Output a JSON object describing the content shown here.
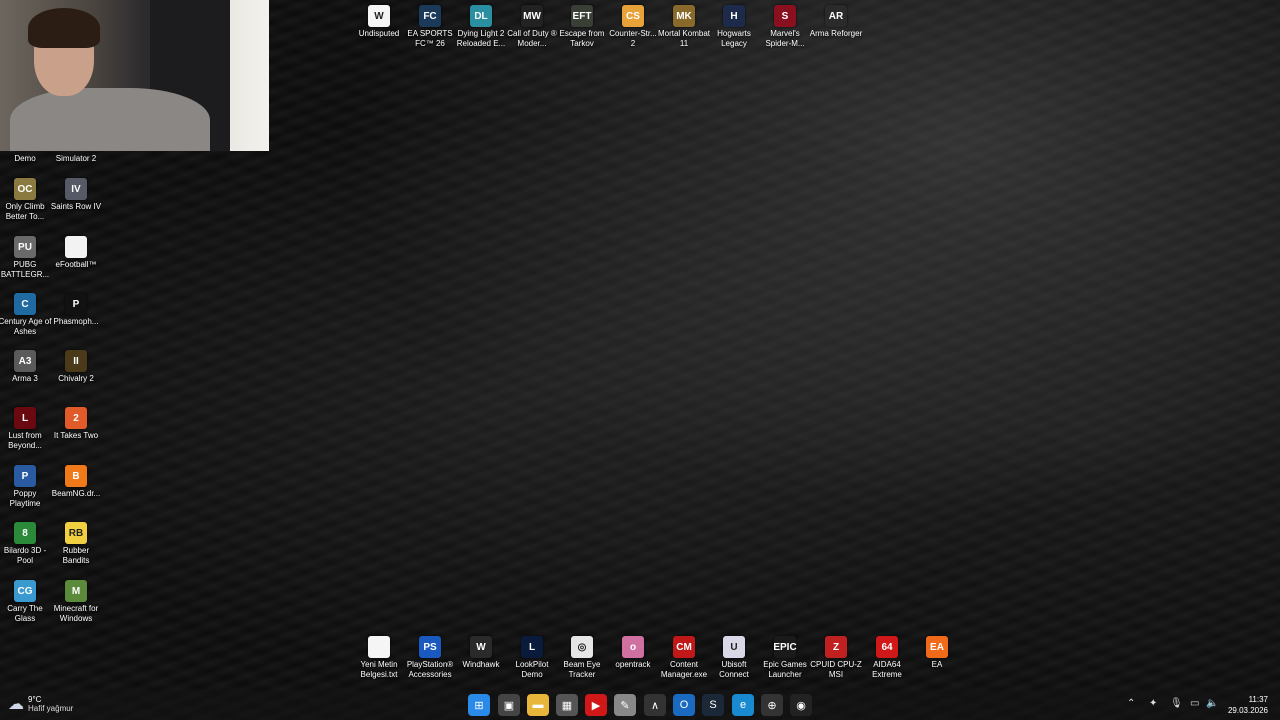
{
  "desktop": {
    "top_icons": [
      {
        "label": "Undisputed",
        "icon": "undisputed-icon",
        "color": "#f5f5f5",
        "glyph": "W"
      },
      {
        "label": "EA SPORTS FC™ 26",
        "icon": "ea-fc-icon",
        "color": "#1b3a5a",
        "glyph": "FC"
      },
      {
        "label": "Dying Light 2 Reloaded E...",
        "icon": "dying-light-icon",
        "color": "#2a8fa0",
        "glyph": "DL"
      },
      {
        "label": "Call of Duty ® Moder...",
        "icon": "call-of-duty-icon",
        "color": "#222222",
        "glyph": "MW"
      },
      {
        "label": "Escape from Tarkov",
        "icon": "tarkov-icon",
        "color": "#3a3f36",
        "glyph": "EFT"
      },
      {
        "label": "Counter-Str... 2",
        "icon": "counter-strike-icon",
        "color": "#e8a23a",
        "glyph": "CS"
      },
      {
        "label": "Mortal Kombat 11",
        "icon": "mortal-kombat-icon",
        "color": "#8a6a2a",
        "glyph": "MK"
      },
      {
        "label": "Hogwarts Legacy",
        "icon": "hogwarts-icon",
        "color": "#1e2a4a",
        "glyph": "H"
      },
      {
        "label": "Marvel's Spider-M...",
        "icon": "spider-man-icon",
        "color": "#8a1020",
        "glyph": "S"
      },
      {
        "label": "Arma Reforger",
        "icon": "arma-reforger-icon",
        "color": "#2a2a2a",
        "glyph": "AR"
      }
    ],
    "left_col1": [
      {
        "label": "Demo",
        "icon": "demo-icon",
        "color": "#444444",
        "glyph": ""
      },
      {
        "label": "Only Climb Better To...",
        "icon": "only-climb-icon",
        "color": "#8a7a40",
        "glyph": "OC"
      },
      {
        "label": "PUBG BATTLEGR...",
        "icon": "pubg-icon",
        "color": "#6a6a6a",
        "glyph": "PU"
      },
      {
        "label": "Century Age of Ashes",
        "icon": "century-icon",
        "color": "#1f6aa0",
        "glyph": "C"
      },
      {
        "label": "Arma 3",
        "icon": "arma3-icon",
        "color": "#5a5a5a",
        "glyph": "A3"
      },
      {
        "label": "Lust from Beyond...",
        "icon": "lust-icon",
        "color": "#6a0a10",
        "glyph": "L"
      },
      {
        "label": "Poppy Playtime",
        "icon": "poppy-icon",
        "color": "#2a5aa0",
        "glyph": "P"
      },
      {
        "label": "Bilardo 3D - Pool",
        "icon": "bilardo-icon",
        "color": "#2a8a3a",
        "glyph": "8"
      },
      {
        "label": "Carry The Glass",
        "icon": "carry-glass-icon",
        "color": "#3a9ad0",
        "glyph": "CG"
      }
    ],
    "left_col2": [
      {
        "label": "Simulator 2",
        "icon": "simulator-icon",
        "color": "#444444",
        "glyph": ""
      },
      {
        "label": "Saints Row IV",
        "icon": "saints-row-icon",
        "color": "#555a66",
        "glyph": "IV"
      },
      {
        "label": "eFootball™",
        "icon": "efootball-icon",
        "color": "#f2f2f2",
        "glyph": ""
      },
      {
        "label": "Phasmoph...",
        "icon": "phasmophobia-icon",
        "color": "#111111",
        "glyph": "P"
      },
      {
        "label": "Chivalry 2",
        "icon": "chivalry-icon",
        "color": "#4a3a1a",
        "glyph": "II"
      },
      {
        "label": "It Takes Two",
        "icon": "it-takes-two-icon",
        "color": "#e05a2a",
        "glyph": "2"
      },
      {
        "label": "BeamNG.dr...",
        "icon": "beamng-icon",
        "color": "#f07a1a",
        "glyph": "B"
      },
      {
        "label": "Rubber Bandits",
        "icon": "rubber-bandits-icon",
        "color": "#f0d040",
        "glyph": "RB"
      },
      {
        "label": "Minecraft for Windows",
        "icon": "minecraft-icon",
        "color": "#5a8a3a",
        "glyph": "M"
      }
    ],
    "bottom_icons": [
      {
        "label": "Yeni Metin Belgesi.txt",
        "icon": "text-file-icon",
        "color": "#f5f5f5",
        "glyph": ""
      },
      {
        "label": "PlayStation® Accessories",
        "icon": "playstation-icon",
        "color": "#1a5ac0",
        "glyph": "PS"
      },
      {
        "label": "Windhawk",
        "icon": "windhawk-icon",
        "color": "#2a2a2a",
        "glyph": "W"
      },
      {
        "label": "LookPilot Demo",
        "icon": "lookpilot-icon",
        "color": "#0a1a3a",
        "glyph": "L"
      },
      {
        "label": "Beam Eye Tracker",
        "icon": "beam-eye-icon",
        "color": "#e6e6e6",
        "glyph": "◎"
      },
      {
        "label": "opentrack",
        "icon": "opentrack-icon",
        "color": "#d070a0",
        "glyph": "o"
      },
      {
        "label": "Content Manager.exe",
        "icon": "content-manager-icon",
        "color": "#c01818",
        "glyph": "CM"
      },
      {
        "label": "Ubisoft Connect",
        "icon": "ubisoft-icon",
        "color": "#d8d8e8",
        "glyph": "U"
      },
      {
        "label": "Epic Games Launcher",
        "icon": "epic-games-icon",
        "color": "#1a1a1a",
        "glyph": "EPIC"
      },
      {
        "label": "CPUID CPU-Z MSI",
        "icon": "cpuz-icon",
        "color": "#c02020",
        "glyph": "Z"
      },
      {
        "label": "AIDA64 Extreme",
        "icon": "aida64-icon",
        "color": "#d01818",
        "glyph": "64"
      },
      {
        "label": "EA",
        "icon": "ea-icon",
        "color": "#f06a1a",
        "glyph": "EA"
      }
    ]
  },
  "taskbar": {
    "weather": {
      "temp": "9°C",
      "condition": "Hafif yağmur"
    },
    "apps": [
      {
        "name": "start-icon",
        "color": "#2a8ae8",
        "glyph": "⊞"
      },
      {
        "name": "task-view-icon",
        "color": "#444444",
        "glyph": "▣"
      },
      {
        "name": "file-explorer-icon",
        "color": "#e8b63a",
        "glyph": "▬"
      },
      {
        "name": "store-icon",
        "color": "#555555",
        "glyph": "▦"
      },
      {
        "name": "media-player-icon",
        "color": "#d01818",
        "glyph": "▶"
      },
      {
        "name": "snipping-tool-icon",
        "color": "#888888",
        "glyph": "✎"
      },
      {
        "name": "arc-icon",
        "color": "#333333",
        "glyph": "∧"
      },
      {
        "name": "outlook-icon",
        "color": "#1a6ac0",
        "glyph": "O"
      },
      {
        "name": "steam-icon",
        "color": "#1b2838",
        "glyph": "S"
      },
      {
        "name": "edge-icon",
        "color": "#1a8ad0",
        "glyph": "e"
      },
      {
        "name": "app-icon",
        "color": "#333333",
        "glyph": "⊕"
      },
      {
        "name": "obs-icon",
        "color": "#222222",
        "glyph": "◉"
      }
    ],
    "tray": {
      "time": "11:37",
      "date": "29.03.2026"
    }
  }
}
